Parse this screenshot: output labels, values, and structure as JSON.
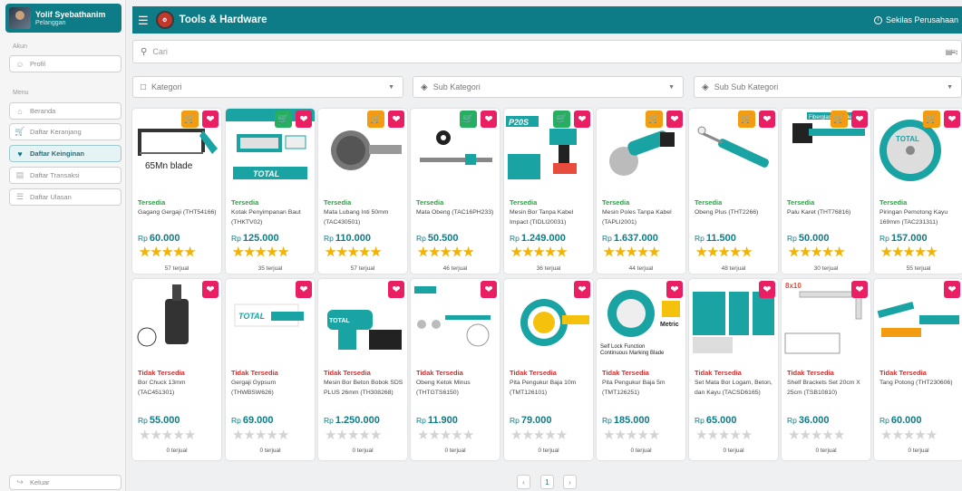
{
  "user": {
    "name": "Yolif Syebathanim",
    "role": "Pelanggan"
  },
  "sidebar": {
    "section_account": "Akun",
    "section_menu": "Menu",
    "profile": "Profil",
    "items": [
      {
        "label": "Beranda",
        "icon": "home-icon"
      },
      {
        "label": "Daftar Keranjang",
        "icon": "cart-icon"
      },
      {
        "label": "Daftar Keinginan",
        "icon": "heart-icon"
      },
      {
        "label": "Daftar Transaksi",
        "icon": "receipt-icon"
      },
      {
        "label": "Daftar Ulasan",
        "icon": "review-icon"
      }
    ],
    "logout": "Keluar"
  },
  "header": {
    "title": "Tools & Hardware",
    "about": "Sekilas Perusahaan"
  },
  "search": {
    "placeholder": "Cari"
  },
  "filters": {
    "category": "Kategori",
    "subcategory": "Sub Kategori",
    "subsubcategory": "Sub Sub Kategori"
  },
  "colors": {
    "primary": "#0e7c86",
    "wish": "#e91e63",
    "cart_orange": "#f39c12",
    "cart_green": "#27ae60",
    "available": "#2e9e45",
    "unavailable": "#d32f2f",
    "star": "#f5b301"
  },
  "products": [
    {
      "status": "Tersedia",
      "name": "Gagang Gergaji (THT54166)",
      "price": "60.000",
      "rating": 5,
      "sold": "57 terjual",
      "cart": "orange",
      "img_text": "65Mn blade"
    },
    {
      "status": "Tersedia",
      "name": "Kotak Penyimpanan Baut (THKTV02)",
      "price": "125.000",
      "rating": 4.5,
      "sold": "35 terjual",
      "cart": "green",
      "img_text": "TOTAL"
    },
    {
      "status": "Tersedia",
      "name": "Mata Lubang Inti 50mm (TAC430501)",
      "price": "110.000",
      "rating": 4.5,
      "sold": "57 terjual",
      "cart": "orange",
      "img_text": ""
    },
    {
      "status": "Tersedia",
      "name": "Mata Obeng (TAC16PH233)",
      "price": "50.500",
      "rating": 5,
      "sold": "46 terjual",
      "cart": "green",
      "img_text": ""
    },
    {
      "status": "Tersedia",
      "name": "Mesin Bor Tanpa Kabel Impact (TIDLI20031)",
      "price": "1.249.000",
      "rating": 5,
      "sold": "36 terjual",
      "cart": "green",
      "img_text": "P20S"
    },
    {
      "status": "Tersedia",
      "name": "Mesin Poles Tanpa Kabel (TAPLI2001)",
      "price": "1.637.000",
      "rating": 5,
      "sold": "44 terjual",
      "cart": "orange",
      "img_text": ""
    },
    {
      "status": "Tersedia",
      "name": "Obeng Plus (THT2266)",
      "price": "11.500",
      "rating": 5,
      "sold": "48 terjual",
      "cart": "orange",
      "img_text": ""
    },
    {
      "status": "Tersedia",
      "name": "Palu Karet (THT76816)",
      "price": "50.000",
      "rating": 4.5,
      "sold": "30 terjual",
      "cart": "orange",
      "img_text": "Fiberglass handle"
    },
    {
      "status": "Tersedia",
      "name": "Piringan Pemotong Kayu 169mm (TAC231311)",
      "price": "157.000",
      "rating": 5,
      "sold": "55 terjual",
      "cart": "orange",
      "img_text": "TOTAL"
    },
    {
      "status": "Tidak Tersedia",
      "name": "Bor Chuck 13mm (TAC451301)",
      "price": "55.000",
      "rating": 0,
      "sold": "0 terjual",
      "cart": "",
      "img_text": "TOTAL"
    },
    {
      "status": "Tidak Tersedia",
      "name": "Gergaji Gypsum (THWBSW626)",
      "price": "69.000",
      "rating": 0,
      "sold": "0 terjual",
      "cart": "",
      "img_text": "TOTAL"
    },
    {
      "status": "Tidak Tersedia",
      "name": "Mesin Bor Beton Bobok SDS PLUS 26mm (TH308268)",
      "price": "1.250.000",
      "rating": 0,
      "sold": "0 terjual",
      "cart": "",
      "img_text": "TOTAL"
    },
    {
      "status": "Tidak Tersedia",
      "name": "Obeng Ketok Minus (THTGTS6150)",
      "price": "11.900",
      "rating": 0,
      "sold": "0 terjual",
      "cart": "",
      "img_text": ""
    },
    {
      "status": "Tidak Tersedia",
      "name": "Pita Pengukur Baja 10m (TMT126101)",
      "price": "79.000",
      "rating": 0,
      "sold": "0 terjual",
      "cart": "",
      "img_text": ""
    },
    {
      "status": "Tidak Tersedia",
      "name": "Pita Pengukur Baja 5m (TMT126251)",
      "price": "185.000",
      "rating": 0,
      "sold": "0 terjual",
      "cart": "",
      "img_text": "Self Lock Function Continuous Marking Blade"
    },
    {
      "status": "Tidak Tersedia",
      "name": "Set Mata Bor Logam, Beton, dan Kayu (TACSD6165)",
      "price": "65.000",
      "rating": 0,
      "sold": "0 terjual",
      "cart": "",
      "img_text": ""
    },
    {
      "status": "Tidak Tersedia",
      "name": "Shelf Brackets Set 20cm X 25cm (TSB10810)",
      "price": "36.000",
      "rating": 0,
      "sold": "0 terjual",
      "cart": "",
      "img_text": "8x10"
    },
    {
      "status": "Tidak Tersedia",
      "name": "Tang Potong (THT230606)",
      "price": "60.000",
      "rating": 0,
      "sold": "0 terjual",
      "cart": "",
      "img_text": ""
    }
  ],
  "currency": "Rp",
  "pagination": {
    "prev": "‹",
    "current": "1",
    "next": "›"
  }
}
